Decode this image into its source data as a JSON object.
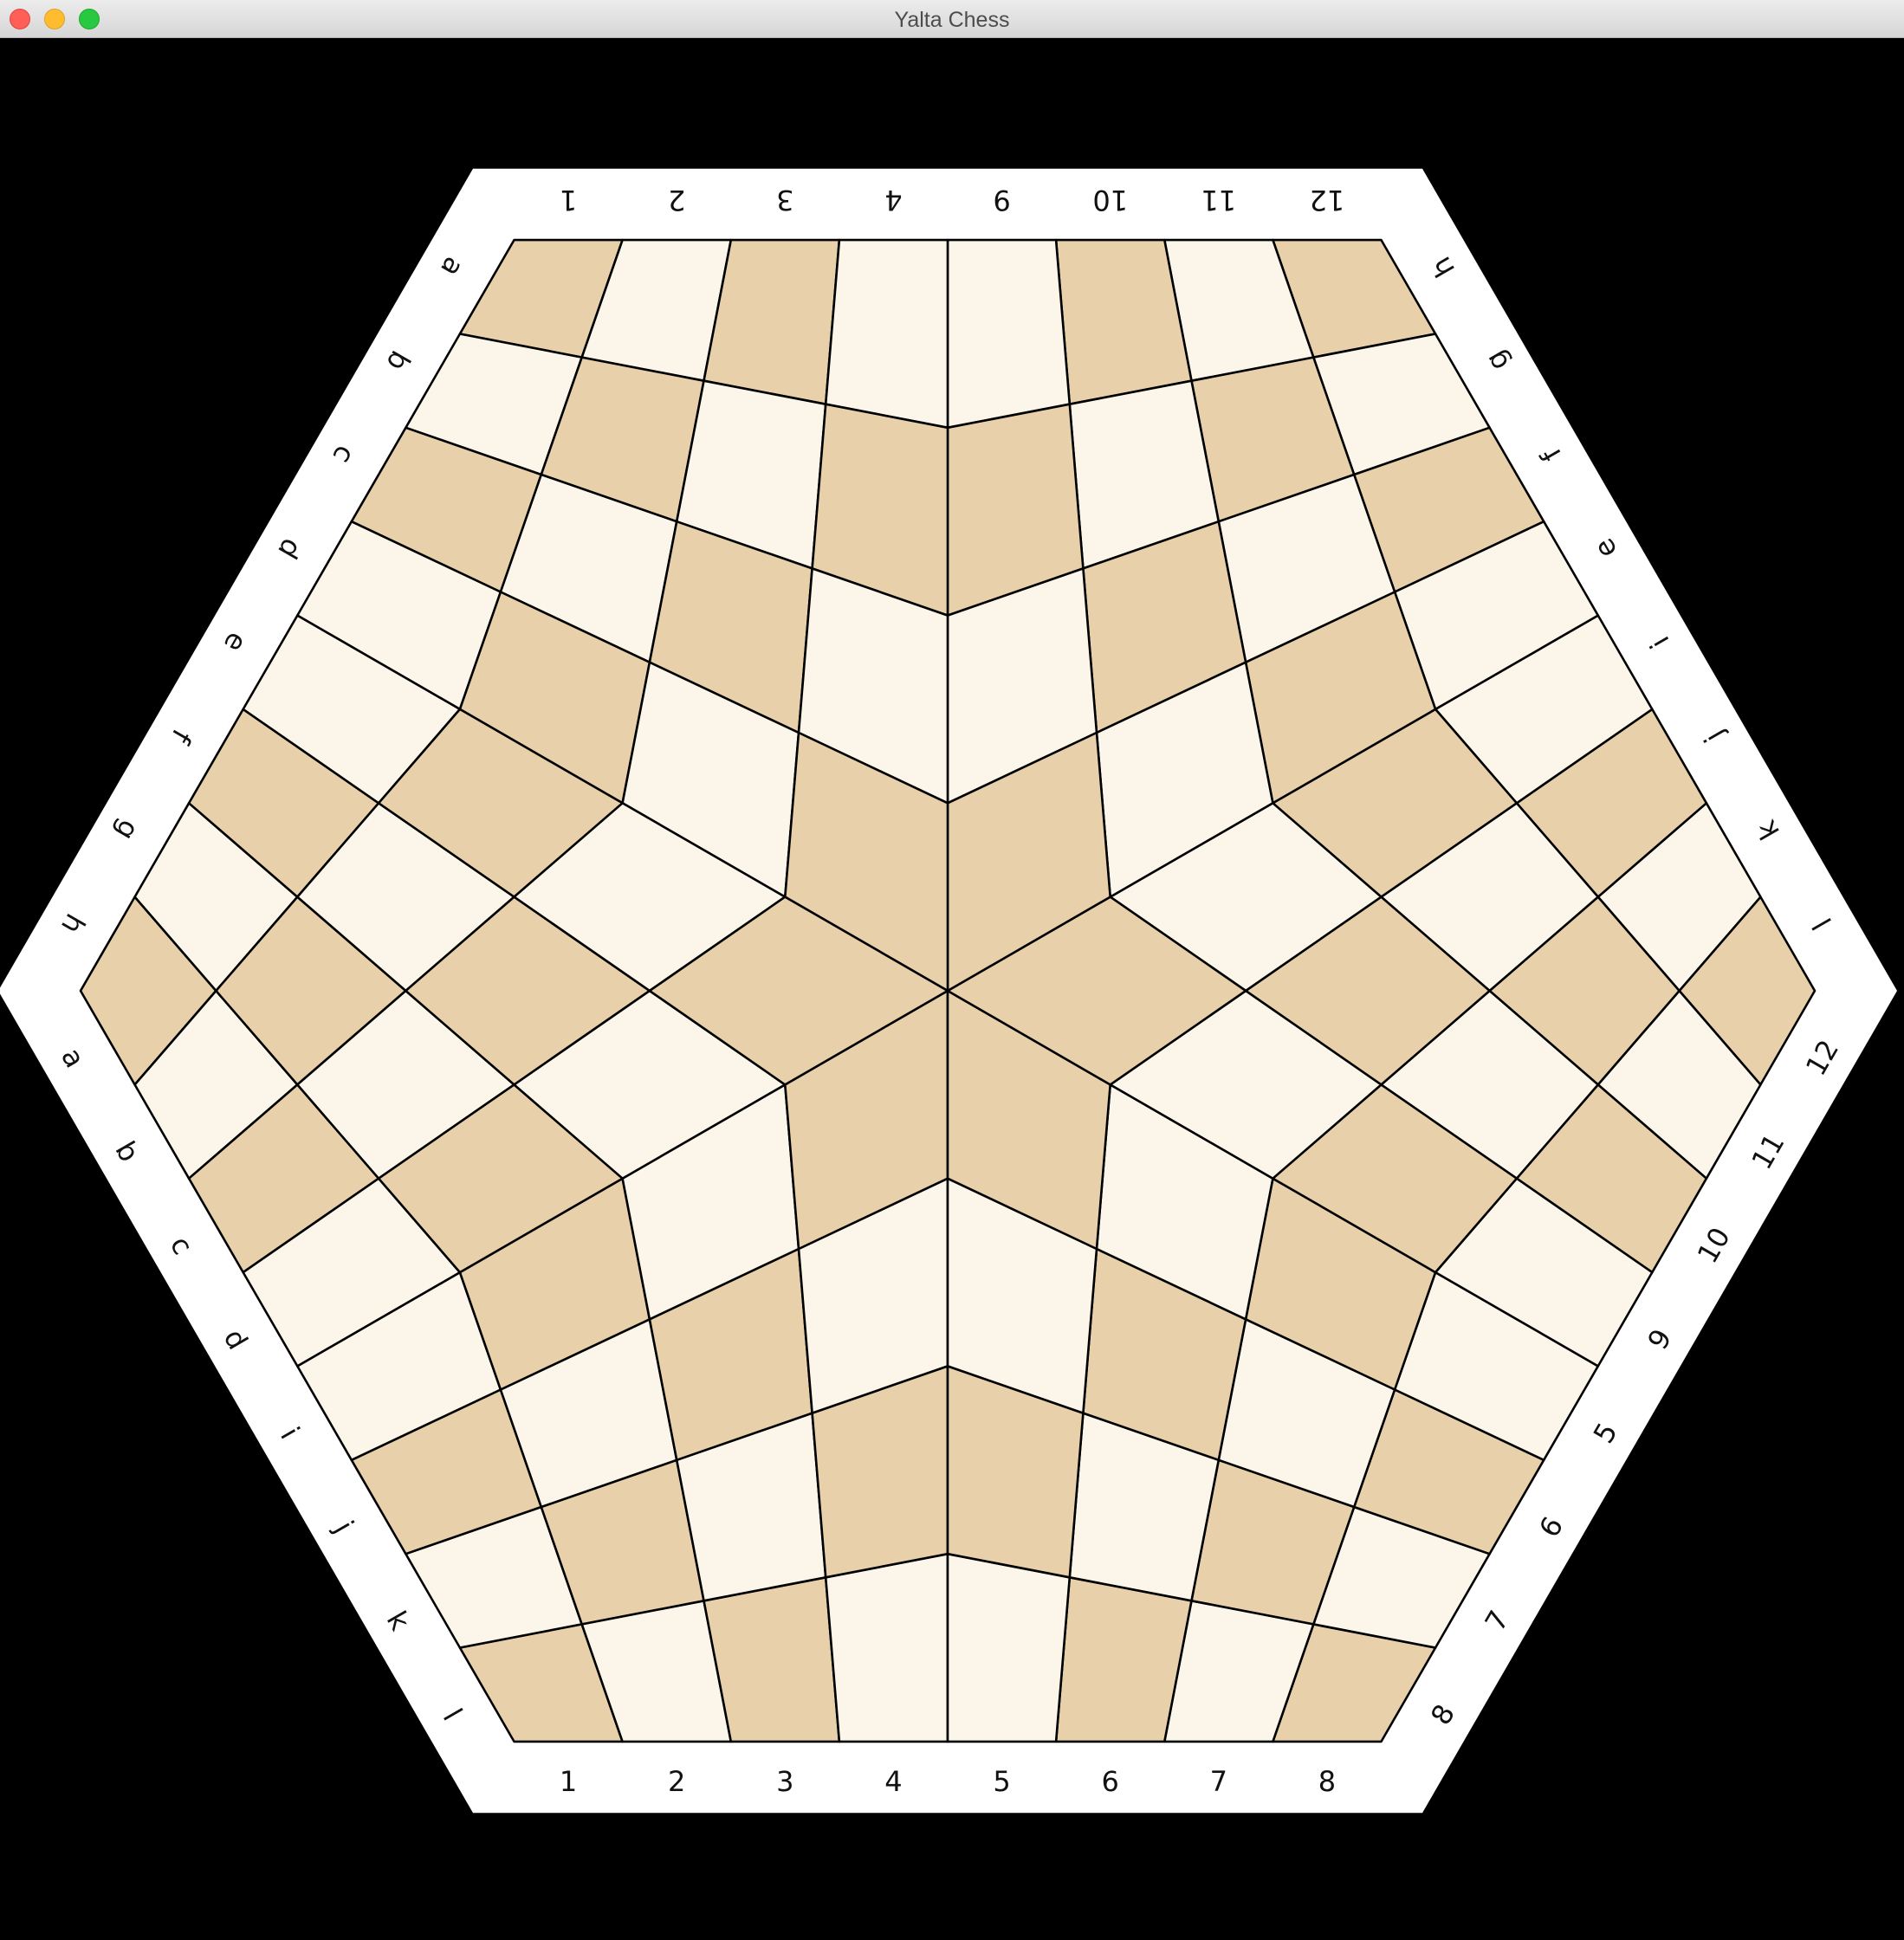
{
  "window": {
    "title": "Yalta Chess",
    "controls": [
      "close",
      "minimize",
      "maximize"
    ]
  },
  "board": {
    "variant": "three-player hexagonal chess board",
    "colors": {
      "light_square": "#FBF6E9",
      "dark_square": "#E8D1AA",
      "frame": "#FFFFFF",
      "lines": "#000000",
      "background": "#000000"
    },
    "edge_labels": [
      [
        "1",
        "2",
        "3",
        "4",
        "5",
        "6",
        "7",
        "8"
      ],
      [
        "8",
        "7",
        "6",
        "5",
        "9",
        "10",
        "11",
        "12"
      ],
      [
        "l",
        "k",
        "j",
        "i",
        "e",
        "f",
        "g",
        "h"
      ],
      [
        "12",
        "11",
        "10",
        "9",
        "4",
        "3",
        "2",
        "1"
      ],
      [
        "a",
        "b",
        "c",
        "d",
        "e",
        "f",
        "g",
        "h"
      ],
      [
        "a",
        "b",
        "c",
        "d",
        "i",
        "j",
        "k",
        "l"
      ]
    ]
  }
}
